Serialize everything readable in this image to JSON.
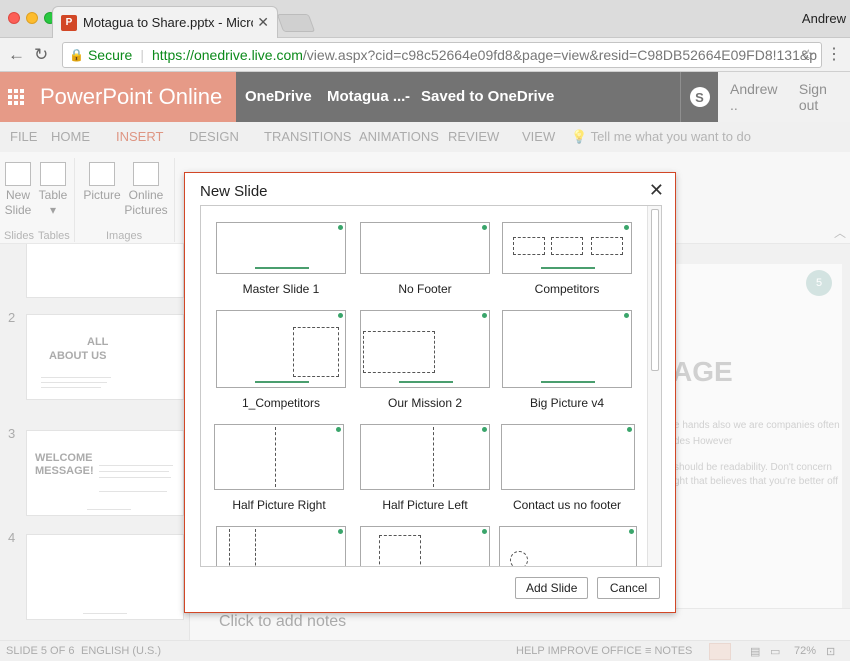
{
  "browser": {
    "tab_title": "Motagua to Share.pptx - Micro",
    "tab_icon": "P",
    "user": "Andrew",
    "secure_label": "Secure",
    "url_host": "https://onedrive.live.com",
    "url_path": "/view.aspx?cid=c98c52664e09fd8&page=view&resid=C98DB52664E09FD8!131&p"
  },
  "office_header": {
    "app_name": "PowerPoint Online",
    "location": "OneDrive",
    "file_name": "Motagua ...",
    "separator": "-",
    "save_status": "Saved to OneDrive",
    "account_name": "Andrew ..",
    "sign_out": "Sign out",
    "brand_color": "#d24726"
  },
  "ribbon": {
    "tabs": [
      "FILE",
      "HOME",
      "INSERT",
      "DESIGN",
      "TRANSITIONS",
      "ANIMATIONS",
      "REVIEW",
      "VIEW"
    ],
    "active_tab": "INSERT",
    "tell_me": "Tell me what you want to do",
    "buttons": {
      "new_slide": [
        "New",
        "Slide"
      ],
      "table": "Table",
      "picture": "Picture",
      "online_pictures": [
        "Online",
        "Pictures"
      ]
    },
    "groups": {
      "slides": "Slides",
      "tables": "Tables",
      "images": "Images"
    }
  },
  "thumbnails": [
    {
      "number": "2",
      "title": [
        "ALL",
        "ABOUT US"
      ]
    },
    {
      "number": "3",
      "title": [
        "WELCOME",
        "MESSAGE!"
      ]
    },
    {
      "number": "4",
      "title": []
    }
  ],
  "slide_preview": {
    "page_badge": "5",
    "heading_fragment": "AGE",
    "body_lines": [
      "e hands also we are companies often",
      "des However",
      "should be readability. Don't concern",
      "ght that believes that you're better off"
    ]
  },
  "notes_placeholder": "Click to add notes",
  "status_bar": {
    "slide_counter": "SLIDE 5 OF 6",
    "language": "ENGLISH (U.S.)",
    "help": "HELP IMPROVE OFFICE",
    "notes": "NOTES",
    "zoom": "72%"
  },
  "dialog": {
    "title": "New Slide",
    "layouts": [
      {
        "name": "Master Slide 1"
      },
      {
        "name": "No Footer"
      },
      {
        "name": "Competitors"
      },
      {
        "name": "1_Competitors"
      },
      {
        "name": "Our Mission 2"
      },
      {
        "name": "Big Picture v4"
      },
      {
        "name": "Half Picture Right"
      },
      {
        "name": "Half Picture Left"
      },
      {
        "name": "Contact us no footer"
      }
    ],
    "add_button": "Add Slide",
    "cancel_button": "Cancel"
  }
}
